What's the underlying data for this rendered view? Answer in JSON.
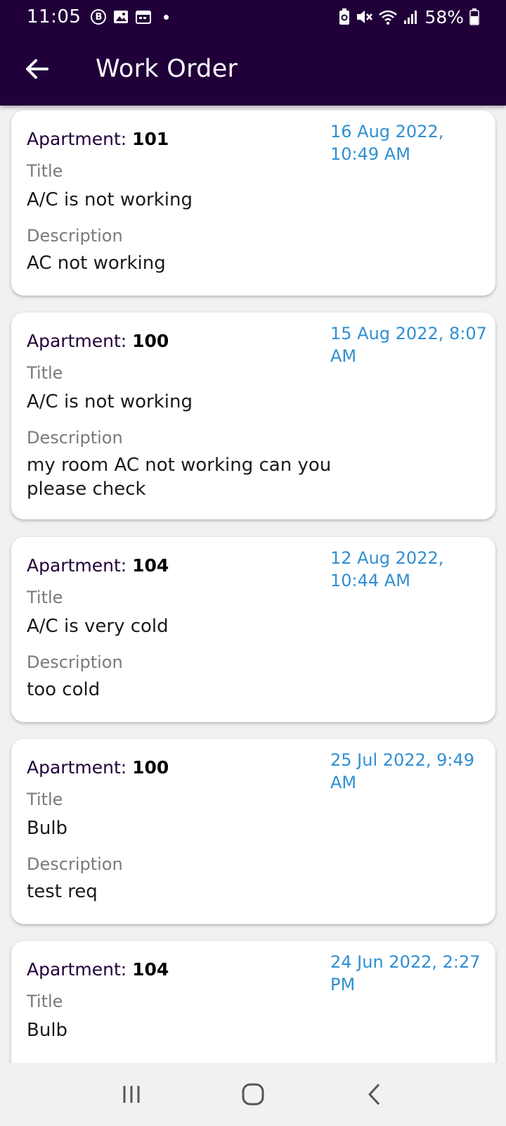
{
  "status_bar": {
    "time": "11:05",
    "battery": "58%",
    "icons": [
      "b-circle-icon",
      "image-icon",
      "calendar-icon",
      "dot-icon",
      "battery-saver-icon",
      "mute-icon",
      "wifi-icon",
      "signal-icon",
      "battery-icon"
    ]
  },
  "app_bar": {
    "title": "Work Order",
    "back_icon": "arrow-left-icon"
  },
  "labels": {
    "apartment": "Apartment: ",
    "title": "Title",
    "description": "Description"
  },
  "work_orders": [
    {
      "apartment": "101",
      "date": "16 Aug 2022, 10:49 AM",
      "title": "A/C is not working",
      "description": "AC not working"
    },
    {
      "apartment": "100",
      "date": "15 Aug 2022, 8:07 AM",
      "title": "A/C is not working",
      "description": "my room AC not working can you please check"
    },
    {
      "apartment": "104",
      "date": "12 Aug 2022, 10:44 AM",
      "title": "A/C is very cold",
      "description": "too cold"
    },
    {
      "apartment": "100",
      "date": "25 Jul 2022, 9:49 AM",
      "title": "Bulb",
      "description": "test req"
    },
    {
      "apartment": "104",
      "date": "24 Jun 2022, 2:27 PM",
      "title": "Bulb",
      "description": ""
    }
  ],
  "nav_bar": {
    "icons": [
      "recent-apps-icon",
      "home-icon",
      "back-icon"
    ]
  },
  "colors": {
    "app_bar": "#21003a",
    "date": "#2f8fd2",
    "background": "#f1f1f1"
  }
}
